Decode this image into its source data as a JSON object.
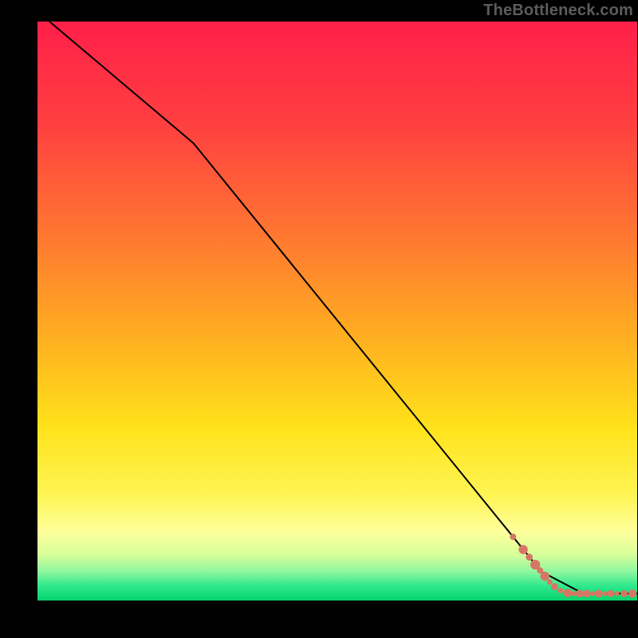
{
  "watermark": "TheBottleneck.com",
  "chart_data": {
    "type": "line",
    "title": "",
    "xlabel": "",
    "ylabel": "",
    "xlim": [
      0,
      100
    ],
    "ylim": [
      0,
      100
    ],
    "curve": [
      {
        "x": 2,
        "y": 100
      },
      {
        "x": 26,
        "y": 79
      },
      {
        "x": 84,
        "y": 5
      },
      {
        "x": 91,
        "y": 1.2
      },
      {
        "x": 100,
        "y": 1.2
      }
    ],
    "points": [
      {
        "x": 79.3,
        "y": 11.0,
        "r": 1.8
      },
      {
        "x": 81.0,
        "y": 8.8,
        "r": 2.6
      },
      {
        "x": 82.0,
        "y": 7.5,
        "r": 2.0
      },
      {
        "x": 83.0,
        "y": 6.2,
        "r": 2.8
      },
      {
        "x": 83.8,
        "y": 5.2,
        "r": 1.8
      },
      {
        "x": 84.6,
        "y": 4.2,
        "r": 2.6
      },
      {
        "x": 85.4,
        "y": 3.2,
        "r": 1.6
      },
      {
        "x": 86.2,
        "y": 2.4,
        "r": 2.0
      },
      {
        "x": 87.2,
        "y": 1.7,
        "r": 1.6
      },
      {
        "x": 88.4,
        "y": 1.3,
        "r": 2.4
      },
      {
        "x": 89.4,
        "y": 1.2,
        "r": 1.4
      },
      {
        "x": 90.4,
        "y": 1.2,
        "r": 2.2
      },
      {
        "x": 91.6,
        "y": 1.2,
        "r": 2.2
      },
      {
        "x": 92.6,
        "y": 1.2,
        "r": 1.4
      },
      {
        "x": 93.6,
        "y": 1.2,
        "r": 2.2
      },
      {
        "x": 94.6,
        "y": 1.2,
        "r": 1.4
      },
      {
        "x": 95.6,
        "y": 1.2,
        "r": 2.0
      },
      {
        "x": 96.6,
        "y": 1.2,
        "r": 1.4
      },
      {
        "x": 97.8,
        "y": 1.2,
        "r": 2.0
      },
      {
        "x": 99.2,
        "y": 1.2,
        "r": 2.4
      }
    ],
    "gradient_stops": [
      {
        "offset": 0.0,
        "color": "#ff1f49"
      },
      {
        "offset": 0.18,
        "color": "#ff4040"
      },
      {
        "offset": 0.38,
        "color": "#ff7a30"
      },
      {
        "offset": 0.55,
        "color": "#ffb020"
      },
      {
        "offset": 0.7,
        "color": "#ffe21a"
      },
      {
        "offset": 0.82,
        "color": "#fff555"
      },
      {
        "offset": 0.88,
        "color": "#feff9a"
      },
      {
        "offset": 0.92,
        "color": "#d9ff9a"
      },
      {
        "offset": 0.95,
        "color": "#8ff7a0"
      },
      {
        "offset": 0.975,
        "color": "#2fe88c"
      },
      {
        "offset": 1.0,
        "color": "#05d36b"
      }
    ],
    "curve_color": "#000000",
    "point_color": "#d67765"
  }
}
